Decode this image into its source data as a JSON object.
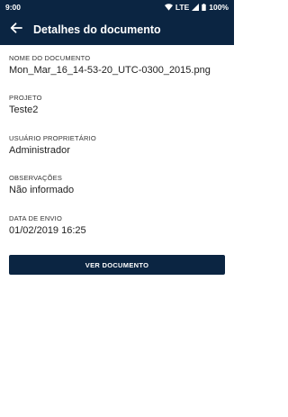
{
  "status_bar": {
    "time": "9:00",
    "network": "LTE",
    "battery": "100%"
  },
  "app_bar": {
    "title": "Detalhes do documento",
    "back_icon": "arrow-left-icon"
  },
  "fields": [
    {
      "label": "NOME DO DOCUMENTO",
      "value": "Mon_Mar_16_14-53-20_UTC-0300_2015.png"
    },
    {
      "label": "PROJETO",
      "value": "Teste2"
    },
    {
      "label": "USUÁRIO PROPRIETÁRIO",
      "value": "Administrador"
    },
    {
      "label": "OBSERVAÇÕES",
      "value": "Não informado"
    },
    {
      "label": "DATA DE ENVIO",
      "value": "01/02/2019 16:25"
    }
  ],
  "actions": {
    "view_document_label": "VER DOCUMENTO"
  },
  "colors": {
    "primary": "#0b2542",
    "background": "#ffffff",
    "text": "#222222"
  }
}
